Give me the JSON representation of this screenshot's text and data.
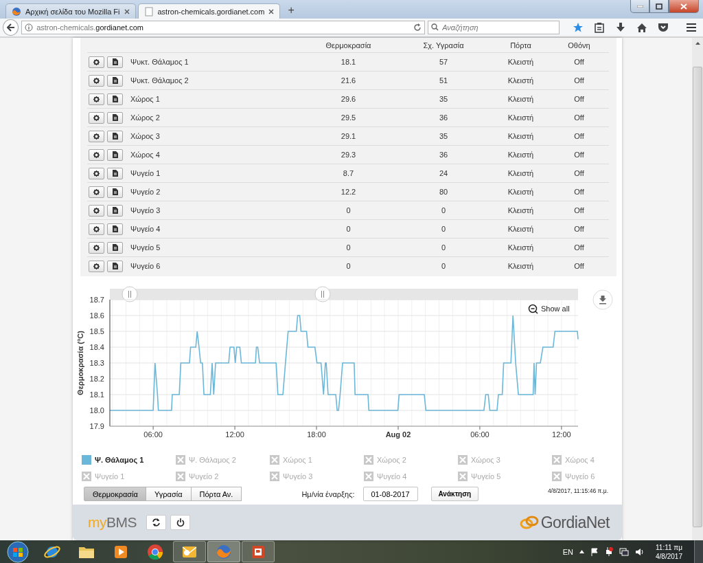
{
  "browser": {
    "tabs": [
      {
        "label": "Αρχική σελίδα του Mozilla Fi",
        "selected": false
      },
      {
        "label": "astron-chemicals.gordianet.com",
        "selected": true
      }
    ],
    "new_tab": "+",
    "url_prefix": "astron-chemicals.",
    "url_domain": "gordianet.com",
    "search_placeholder": "Αναζήτηση"
  },
  "table": {
    "columns": [
      "Θερμοκρασία",
      "Σχ. Υγρασία",
      "Πόρτα",
      "Οθόνη"
    ],
    "rows": [
      {
        "name": "Ψυκτ. Θάλαμος 1",
        "temperature": "18.1",
        "humidity": "57",
        "door": "Κλειστή",
        "screen": "Off"
      },
      {
        "name": "Ψυκτ. Θάλαμος 2",
        "temperature": "21.6",
        "humidity": "51",
        "door": "Κλειστή",
        "screen": "Off"
      },
      {
        "name": "Χώρος 1",
        "temperature": "29.6",
        "humidity": "35",
        "door": "Κλειστή",
        "screen": "Off"
      },
      {
        "name": "Χώρος 2",
        "temperature": "29.5",
        "humidity": "36",
        "door": "Κλειστή",
        "screen": "Off"
      },
      {
        "name": "Χώρος 3",
        "temperature": "29.1",
        "humidity": "35",
        "door": "Κλειστή",
        "screen": "Off"
      },
      {
        "name": "Χώρος 4",
        "temperature": "29.3",
        "humidity": "36",
        "door": "Κλειστή",
        "screen": "Off"
      },
      {
        "name": "Ψυγείο 1",
        "temperature": "8.7",
        "humidity": "24",
        "door": "Κλειστή",
        "screen": "Off"
      },
      {
        "name": "Ψυγείο 2",
        "temperature": "12.2",
        "humidity": "80",
        "door": "Κλειστή",
        "screen": "Off"
      },
      {
        "name": "Ψυγείο 3",
        "temperature": "0",
        "humidity": "0",
        "door": "Κλειστή",
        "screen": "Off"
      },
      {
        "name": "Ψυγείο 4",
        "temperature": "0",
        "humidity": "0",
        "door": "Κλειστή",
        "screen": "Off"
      },
      {
        "name": "Ψυγείο 5",
        "temperature": "0",
        "humidity": "0",
        "door": "Κλειστή",
        "screen": "Off"
      },
      {
        "name": "Ψυγείο 6",
        "temperature": "0",
        "humidity": "0",
        "door": "Κλειστή",
        "screen": "Off"
      }
    ]
  },
  "chart": {
    "show_all": "Show all",
    "chart_data": {
      "type": "line",
      "ylabel": "Θερμοκρασία (°C)",
      "grid": true,
      "x": [
        "2017-08-01T02:49",
        "2017-08-01T06:00",
        "2017-08-01T06:08",
        "2017-08-01T06:19",
        "2017-08-01T06:23",
        "2017-08-01T07:21",
        "2017-08-01T07:24",
        "2017-08-01T07:55",
        "2017-08-01T08:02",
        "2017-08-01T08:40",
        "2017-08-01T08:45",
        "2017-08-01T09:08",
        "2017-08-01T09:14",
        "2017-08-01T09:22",
        "2017-08-01T09:29",
        "2017-08-01T09:37",
        "2017-08-01T09:44",
        "2017-08-01T10:12",
        "2017-08-01T10:20",
        "2017-08-01T10:27",
        "2017-08-01T10:35",
        "2017-08-01T11:33",
        "2017-08-01T11:39",
        "2017-08-01T11:56",
        "2017-08-01T12:02",
        "2017-08-01T12:08",
        "2017-08-01T12:22",
        "2017-08-01T12:29",
        "2017-08-01T13:31",
        "2017-08-01T13:35",
        "2017-08-01T13:41",
        "2017-08-01T13:49",
        "2017-08-01T15:02",
        "2017-08-01T15:10",
        "2017-08-01T15:32",
        "2017-08-01T15:43",
        "2017-08-01T15:55",
        "2017-08-01T16:31",
        "2017-08-01T16:37",
        "2017-08-01T16:46",
        "2017-08-01T16:52",
        "2017-08-01T17:16",
        "2017-08-01T17:22",
        "2017-08-01T17:53",
        "2017-08-01T18:02",
        "2017-08-01T18:20",
        "2017-08-01T18:31",
        "2017-08-01T18:39",
        "2017-08-01T18:43",
        "2017-08-01T18:51",
        "2017-08-01T19:25",
        "2017-08-01T19:31",
        "2017-08-01T19:37",
        "2017-08-01T19:44",
        "2017-08-01T19:55",
        "2017-08-01T20:46",
        "2017-08-01T20:50",
        "2017-08-01T21:47",
        "2017-08-01T21:51",
        "2017-08-01T23:59",
        "2017-08-02T00:04",
        "2017-08-02T01:55",
        "2017-08-02T02:02",
        "2017-08-02T06:18",
        "2017-08-02T06:26",
        "2017-08-02T06:37",
        "2017-08-02T06:44",
        "2017-08-02T07:16",
        "2017-08-02T07:22",
        "2017-08-02T07:39",
        "2017-08-02T07:45",
        "2017-08-02T08:17",
        "2017-08-02T08:26",
        "2017-08-02T08:38",
        "2017-08-02T08:50",
        "2017-08-02T09:55",
        "2017-08-02T09:59",
        "2017-08-02T10:04",
        "2017-08-02T10:10",
        "2017-08-02T10:27",
        "2017-08-02T10:38",
        "2017-08-02T11:23",
        "2017-08-02T11:31",
        "2017-08-02T13:10",
        "2017-08-02T13:13"
      ],
      "series": [
        {
          "color": "#6ab7d9",
          "values": [
            18.0,
            18.0,
            18.3,
            18.1,
            18.0,
            18.0,
            18.1,
            18.1,
            18.3,
            18.3,
            18.4,
            18.4,
            18.5,
            18.4,
            18.3,
            18.3,
            18.1,
            18.1,
            18.3,
            18.1,
            18.3,
            18.3,
            18.4,
            18.4,
            18.3,
            18.4,
            18.4,
            18.3,
            18.3,
            18.4,
            18.4,
            18.3,
            18.3,
            18.1,
            18.1,
            18.3,
            18.5,
            18.5,
            18.6,
            18.6,
            18.5,
            18.5,
            18.4,
            18.4,
            18.3,
            18.3,
            18.1,
            18.3,
            18.3,
            18.1,
            18.1,
            18.0,
            18.0,
            18.1,
            18.3,
            18.3,
            18.1,
            18.1,
            18.0,
            18.0,
            18.1,
            18.1,
            18.0,
            18.0,
            18.1,
            18.1,
            18.0,
            18.0,
            18.1,
            18.1,
            18.3,
            18.3,
            18.6,
            18.3,
            18.1,
            18.1,
            18.3,
            18.1,
            18.3,
            18.3,
            18.4,
            18.4,
            18.5,
            18.5,
            18.45
          ]
        }
      ],
      "xlim": [
        "2017-08-01T02:49",
        "2017-08-02T13:13"
      ],
      "ylim": [
        17.9,
        18.7
      ],
      "xticks": [
        {
          "value": "2017-08-01T06:00",
          "label": "06:00"
        },
        {
          "value": "2017-08-01T12:00",
          "label": "12:00"
        },
        {
          "value": "2017-08-01T18:00",
          "label": "18:00"
        },
        {
          "value": "2017-08-02T00:00",
          "label": "Aug 02"
        },
        {
          "value": "2017-08-02T06:00",
          "label": "06:00"
        },
        {
          "value": "2017-08-02T12:00",
          "label": "12:00"
        }
      ],
      "yticks": [
        {
          "value": 17.9,
          "label": "17.9"
        },
        {
          "value": 18.0,
          "label": "18.0"
        },
        {
          "value": 18.1,
          "label": "18.1"
        },
        {
          "value": 18.2,
          "label": "18.2"
        },
        {
          "value": 18.3,
          "label": "18.3"
        },
        {
          "value": 18.4,
          "label": "18.4"
        },
        {
          "value": 18.5,
          "label": "18.5"
        },
        {
          "value": 18.6,
          "label": "18.6"
        },
        {
          "value": 18.7,
          "label": "18.7"
        }
      ]
    }
  },
  "legend": [
    {
      "label": "Ψ. Θάλαμος 1",
      "visible": true
    },
    {
      "label": "Ψ. Θάλαμος 2",
      "visible": false
    },
    {
      "label": "Χώρος 1",
      "visible": false
    },
    {
      "label": "Χώρος 2",
      "visible": false
    },
    {
      "label": "Χώρος 3",
      "visible": false
    },
    {
      "label": "Χώρος 4",
      "visible": false
    },
    {
      "label": "Ψυγείο 1",
      "visible": false
    },
    {
      "label": "Ψυγείο 2",
      "visible": false
    },
    {
      "label": "Ψυγείο 3",
      "visible": false
    },
    {
      "label": "Ψυγείο 4",
      "visible": false
    },
    {
      "label": "Ψυγείο 5",
      "visible": false
    },
    {
      "label": "Ψυγείο 6",
      "visible": false
    }
  ],
  "controls": {
    "views": [
      {
        "label": "Θερμοκρασία",
        "selected": true
      },
      {
        "label": "Υγρασία",
        "selected": false
      },
      {
        "label": "Πόρτα Αν.",
        "selected": false
      }
    ],
    "start_date_label": "Ημ/νία έναρξης:",
    "start_date": "01-08-2017",
    "fetch_button": "Ανάκτηση",
    "timestamp": "4/8/2017, 11:15:46 π.μ."
  },
  "footer": {
    "app_name_prefix": "my",
    "app_name": "BMS",
    "brand": "GordiaNet"
  },
  "taskbar": {
    "language": "EN",
    "time": "11:11 πμ",
    "date": "4/8/2017"
  }
}
